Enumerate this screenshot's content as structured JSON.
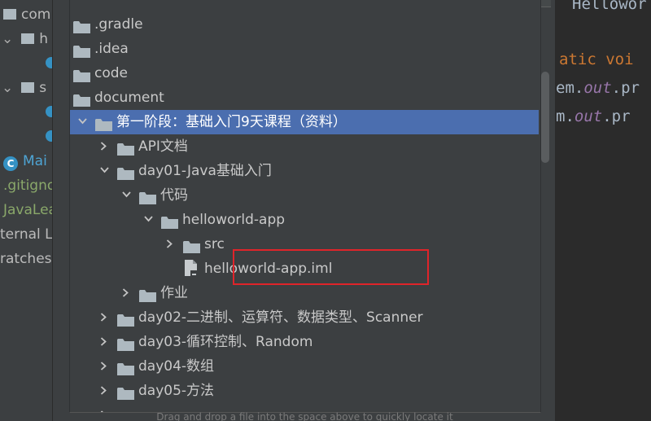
{
  "background_project": {
    "rows": [
      "com",
      "h",
      "",
      "s",
      "",
      "",
      "Mai",
      ".gitigno",
      "JavaLea",
      "ternal Li",
      "ratches"
    ]
  },
  "background_editor": {
    "lines": [
      "Hellowor",
      "",
      "atic voi",
      "em.out.pr",
      "m.out.pr"
    ]
  },
  "tree": {
    "rows": [
      {
        "label": ".gradle",
        "depth": 0,
        "expanded": false,
        "icon": "folder-icon"
      },
      {
        "label": ".idea",
        "depth": 0,
        "expanded": false,
        "icon": "folder-icon"
      },
      {
        "label": "code",
        "depth": 0,
        "expanded": false,
        "icon": "folder-icon"
      },
      {
        "label": "document",
        "depth": 0,
        "expanded": true,
        "icon": "folder-icon"
      },
      {
        "label": "第一阶段：基础入门9天课程（资料）",
        "depth": 1,
        "expanded": true,
        "icon": "folder-icon",
        "selected": true
      },
      {
        "label": "API文档",
        "depth": 2,
        "expanded": false,
        "icon": "folder-icon"
      },
      {
        "label": "day01-Java基础入门",
        "depth": 2,
        "expanded": true,
        "icon": "folder-icon"
      },
      {
        "label": "代码",
        "depth": 3,
        "expanded": true,
        "icon": "folder-icon"
      },
      {
        "label": "helloworld-app",
        "depth": 4,
        "expanded": true,
        "icon": "folder-icon"
      },
      {
        "label": "src",
        "depth": 5,
        "expanded": false,
        "icon": "folder-icon"
      },
      {
        "label": "helloworld-app.iml",
        "depth": 5,
        "expanded": null,
        "icon": "file-icon"
      },
      {
        "label": "作业",
        "depth": 3,
        "expanded": false,
        "icon": "folder-icon"
      },
      {
        "label": "day02-二进制、运算符、数据类型、Scanner",
        "depth": 2,
        "expanded": false,
        "icon": "folder-icon"
      },
      {
        "label": "day03-循环控制、Random",
        "depth": 2,
        "expanded": false,
        "icon": "folder-icon"
      },
      {
        "label": "day04-数组",
        "depth": 2,
        "expanded": false,
        "icon": "folder-icon"
      },
      {
        "label": "day05-方法",
        "depth": 2,
        "expanded": false,
        "icon": "folder-icon"
      },
      {
        "label": "",
        "depth": 2,
        "expanded": false,
        "icon": "folder-icon"
      }
    ]
  },
  "hint": "Drag and drop a file into the space above to quickly locate it",
  "colors": {
    "selection": "#4b6eaf",
    "highlight_border": "#e0242a",
    "folder": "#aeb9c0",
    "keyword": "#cc7832",
    "field": "#9876aa"
  }
}
